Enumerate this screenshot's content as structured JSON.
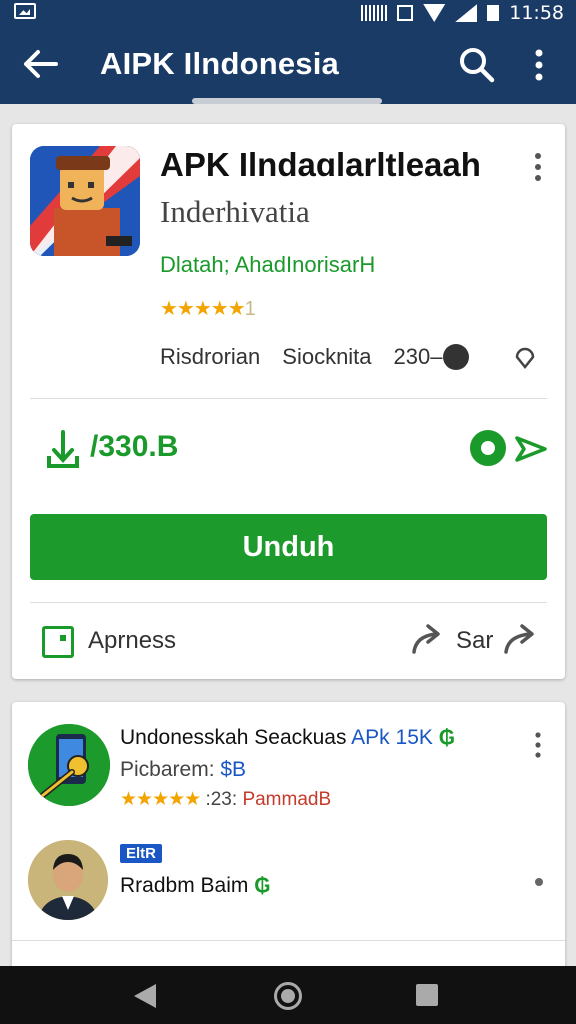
{
  "status_bar": {
    "time": "11:58",
    "icons": [
      "image-icon",
      "vibrate-icon",
      "dnd-icon",
      "wifi-icon",
      "signal-icon",
      "battery-icon"
    ]
  },
  "appbar": {
    "title": "AIPK Ilndonesia",
    "back_icon": "back-arrow-icon",
    "search_icon": "search-icon",
    "menu_icon": "more-vert-icon"
  },
  "app": {
    "title": "APK Ilndaɑlarltleaah",
    "subtitle": "Inderhivatia",
    "developer": "Dlatah;  AhadInorisarH",
    "rating_stars": "★★★★★",
    "rating_suffix": "1",
    "meta": {
      "item1": "Risdrorian",
      "item2": "Siocknita",
      "item3": "230–"
    },
    "size": "/330.B",
    "download_label": "Unduh",
    "apps_label": "Aprness",
    "share_label": "Sar"
  },
  "list": [
    {
      "title": "Undonesskah Seackuas",
      "title_accent": "APk 15K",
      "title_suffix": "₲",
      "price_label": "Picbarem:",
      "price_value": "$B",
      "stars": "★★★★★",
      "rating_text": " :23:",
      "rating_red": "PammadB"
    },
    {
      "badge": "EltR",
      "name": "Rradbm Baim",
      "name_suffix": "₲"
    }
  ],
  "colors": {
    "primary": "#1b3b67",
    "accent_green": "#1d9a2c",
    "star": "#f4a400",
    "link_blue": "#1a56c4"
  }
}
